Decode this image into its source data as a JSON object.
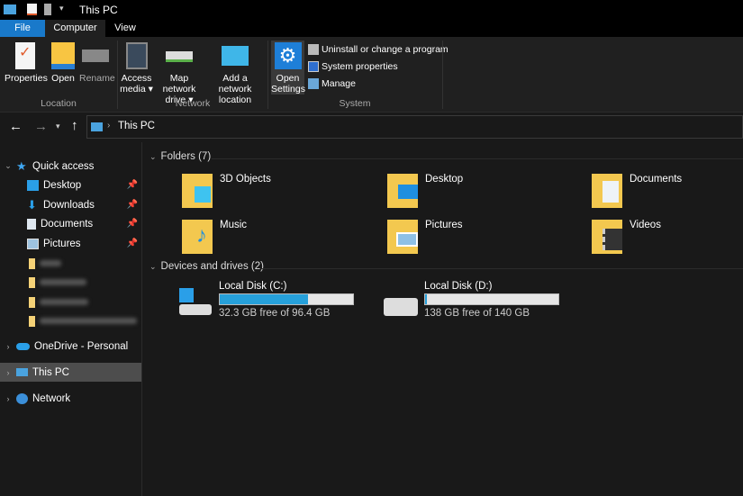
{
  "window": {
    "title": "This PC"
  },
  "ribbon_tabs": [
    "File",
    "Computer",
    "View"
  ],
  "ribbon": {
    "location": {
      "label": "Location",
      "buttons": [
        "Properties",
        "Open",
        "Rename"
      ]
    },
    "network": {
      "label": "Network",
      "buttons": [
        [
          "Access",
          "media ▾"
        ],
        [
          "Map network",
          "drive ▾"
        ],
        [
          "Add a network",
          "location"
        ]
      ]
    },
    "system": {
      "label": "System",
      "open_settings": [
        "Open",
        "Settings"
      ],
      "items": [
        "Uninstall or change a program",
        "System properties",
        "Manage"
      ]
    }
  },
  "address": {
    "path": "This PC"
  },
  "nav": {
    "quick_access": "Quick access",
    "pinned": [
      "Desktop",
      "Downloads",
      "Documents",
      "Pictures"
    ],
    "onedrive": "OneDrive - Personal",
    "this_pc": "This PC",
    "network": "Network"
  },
  "folders": {
    "header": "Folders (7)",
    "items": [
      "3D Objects",
      "Desktop",
      "Documents",
      "Music",
      "Pictures",
      "Videos"
    ]
  },
  "drives": {
    "header": "Devices and drives (2)",
    "items": [
      {
        "name": "Local Disk (C:)",
        "info": "32.3 GB free of 96.4 GB",
        "used_fraction": 0.665
      },
      {
        "name": "Local Disk (D:)",
        "info": "138 GB free of 140 GB",
        "used_fraction": 0.014
      }
    ]
  },
  "colors": {
    "accent": "#0078d7",
    "bar": "#26a0da"
  }
}
